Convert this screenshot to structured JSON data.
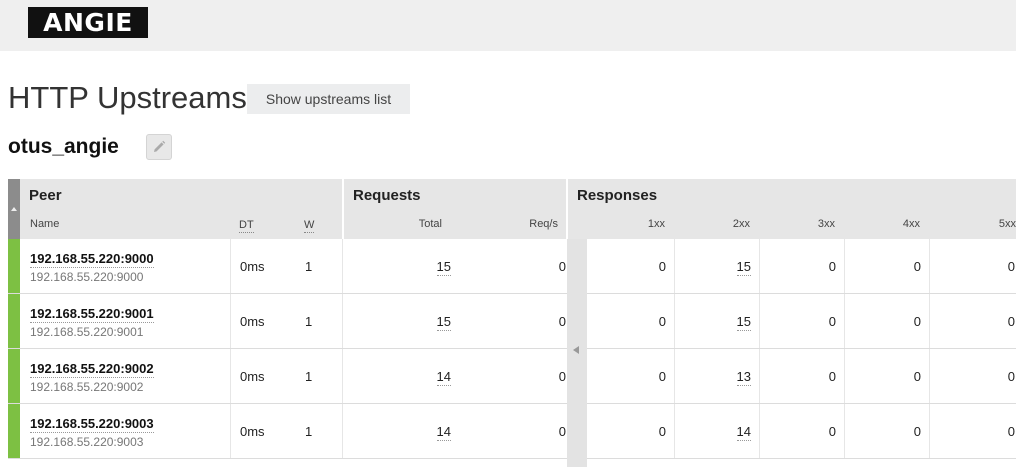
{
  "header": {
    "logo": "ANGIE"
  },
  "page": {
    "title": "HTTP Upstreams",
    "show_list_button": "Show upstreams list"
  },
  "upstream": {
    "name": "otus_angie"
  },
  "table": {
    "groups": {
      "peer": "Peer",
      "requests": "Requests",
      "responses": "Responses"
    },
    "columns": {
      "name": "Name",
      "dt": "DT",
      "w": "W",
      "total": "Total",
      "reqs": "Req/s",
      "r1xx": "1xx",
      "r2xx": "2xx",
      "r3xx": "3xx",
      "r4xx": "4xx",
      "r5xx": "5xx"
    },
    "rows": [
      {
        "name": "192.168.55.220:9000",
        "server": "192.168.55.220:9000",
        "dt": "0ms",
        "w": "1",
        "total": "15",
        "reqs": "0",
        "r1xx": "0",
        "r2xx": "15",
        "r3xx": "0",
        "r4xx": "0",
        "r5xx": "0"
      },
      {
        "name": "192.168.55.220:9001",
        "server": "192.168.55.220:9001",
        "dt": "0ms",
        "w": "1",
        "total": "15",
        "reqs": "0",
        "r1xx": "0",
        "r2xx": "15",
        "r3xx": "0",
        "r4xx": "0",
        "r5xx": "0"
      },
      {
        "name": "192.168.55.220:9002",
        "server": "192.168.55.220:9002",
        "dt": "0ms",
        "w": "1",
        "total": "14",
        "reqs": "0",
        "r1xx": "0",
        "r2xx": "13",
        "r3xx": "0",
        "r4xx": "0",
        "r5xx": "0"
      },
      {
        "name": "192.168.55.220:9003",
        "server": "192.168.55.220:9003",
        "dt": "0ms",
        "w": "1",
        "total": "14",
        "reqs": "0",
        "r1xx": "0",
        "r2xx": "14",
        "r3xx": "0",
        "r4xx": "0",
        "r5xx": "0"
      }
    ]
  },
  "colors": {
    "status_up": "#7dc043",
    "header_bg": "#e6e6e6",
    "topbar_bg": "#efefef"
  },
  "icons": {
    "edit": "pencil-icon",
    "sort": "sort-up-icon",
    "collapse": "collapse-left-icon"
  }
}
